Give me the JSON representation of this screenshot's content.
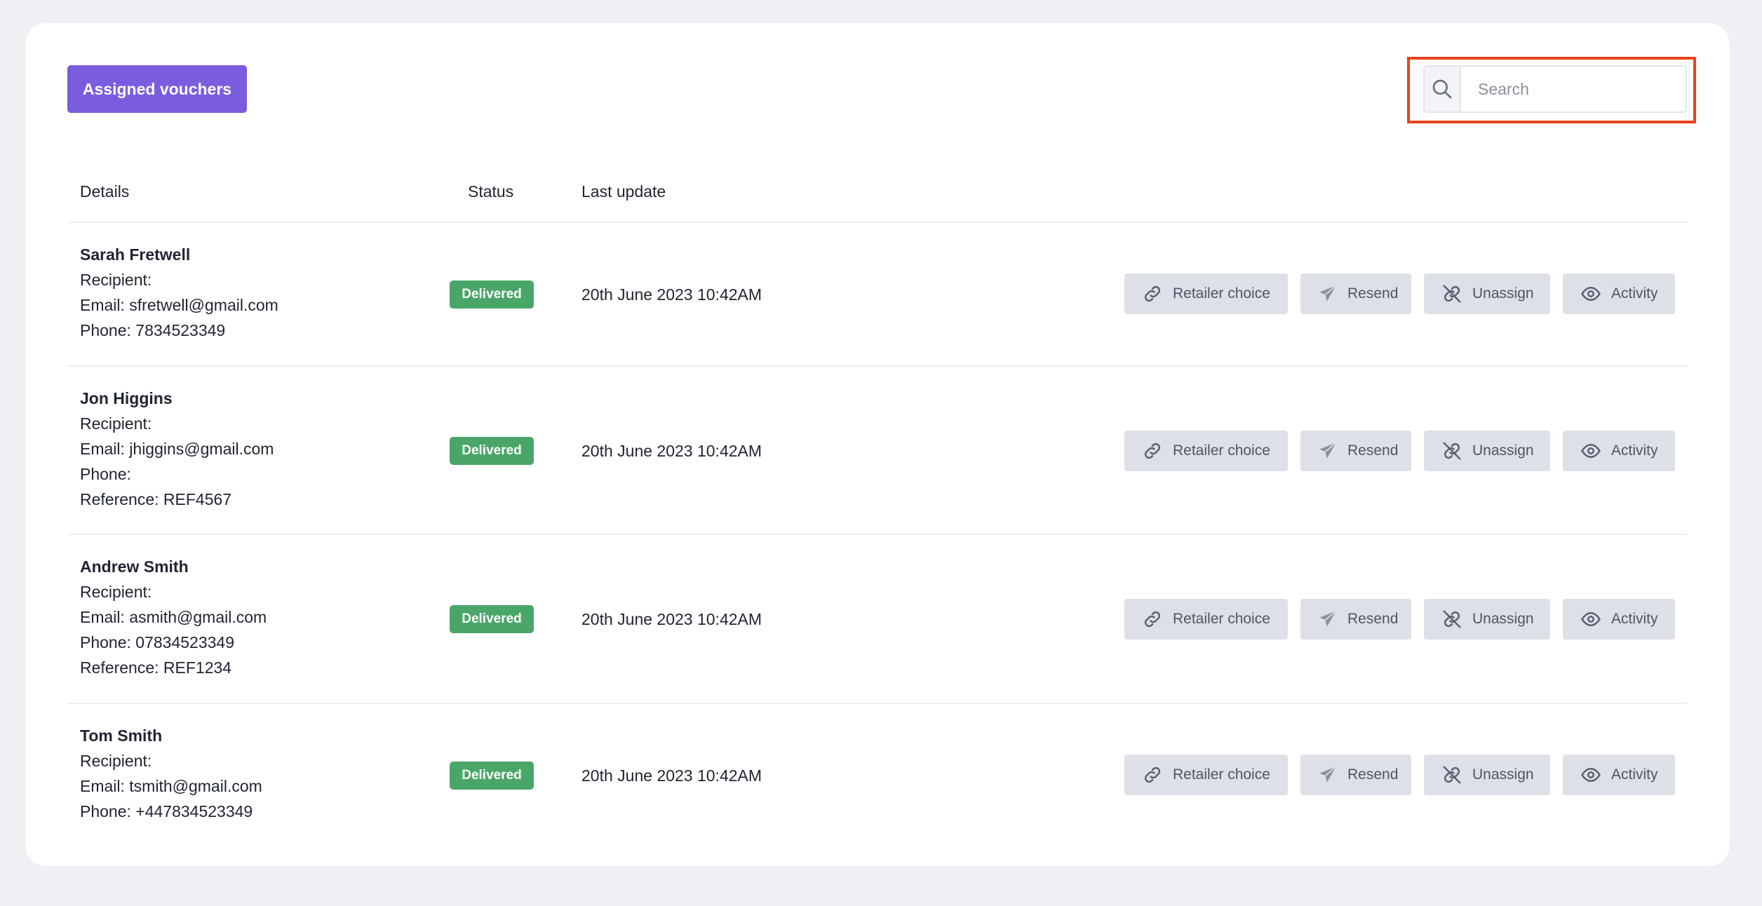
{
  "header": {
    "assigned_button": "Assigned vouchers",
    "search_placeholder": "Search"
  },
  "table": {
    "columns": [
      "Details",
      "Status",
      "Last update"
    ],
    "rows": [
      {
        "name": "Sarah Fretwell",
        "lines": [
          "Recipient:",
          "Email: sfretwell@gmail.com",
          "Phone: 7834523349"
        ],
        "status": "Delivered",
        "last_update": "20th June 2023 10:42AM"
      },
      {
        "name": "Jon Higgins",
        "lines": [
          "Recipient:",
          "Email: jhiggins@gmail.com",
          "Phone:",
          "Reference: REF4567"
        ],
        "status": "Delivered",
        "last_update": "20th June 2023 10:42AM"
      },
      {
        "name": "Andrew Smith",
        "lines": [
          "Recipient:",
          "Email: asmith@gmail.com",
          "Phone: 07834523349",
          "Reference: REF1234"
        ],
        "status": "Delivered",
        "last_update": "20th June 2023 10:42AM"
      },
      {
        "name": "Tom Smith",
        "lines": [
          "Recipient:",
          "Email: tsmith@gmail.com",
          "Phone: +447834523349"
        ],
        "status": "Delivered",
        "last_update": "20th June 2023 10:42AM"
      }
    ],
    "actions": {
      "retailer_choice": "Retailer choice",
      "resend": "Resend",
      "unassign": "Unassign",
      "activity": "Activity"
    }
  },
  "icons": {
    "search": "search-icon",
    "retailer_choice": "link-icon",
    "resend": "paper-plane-icon",
    "unassign": "unlink-icon",
    "activity": "eye-icon"
  },
  "colors": {
    "background": "#efeff4",
    "primary": "#7a5cdf",
    "delivered": "#4aa668",
    "action_button": "#dde0e7",
    "highlight": "#e8431d"
  }
}
